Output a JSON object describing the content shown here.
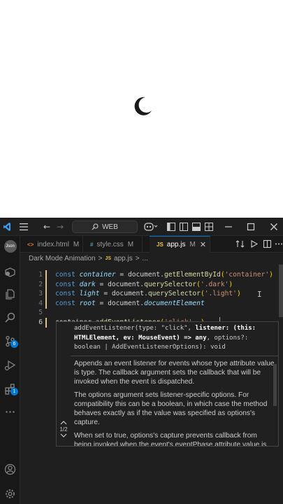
{
  "window": {
    "search_label": "WEB",
    "menu_icon": "hamburger-icon",
    "nav_back_icon": "arrow-left-icon",
    "nav_forward_icon": "arrow-right-icon",
    "copilot_icon": "copilot-icon",
    "layout_icons": [
      "sidebar-left-icon",
      "panel-bottom-icon",
      "sidebar-right-icon",
      "layout-grid-icon"
    ],
    "controls": [
      "minimize-icon",
      "maximize-icon",
      "close-icon"
    ]
  },
  "activity_bar": {
    "avatar_label": "Json",
    "items": [
      {
        "icon": "extensions-box-icon"
      },
      {
        "icon": "files-icon"
      },
      {
        "icon": "search-icon"
      },
      {
        "icon": "source-control-icon",
        "badge": "6"
      },
      {
        "icon": "run-debug-icon"
      },
      {
        "icon": "extensions-icon",
        "badge": "1"
      },
      {
        "icon": "more-icon"
      }
    ],
    "bottom": [
      {
        "icon": "account-icon"
      },
      {
        "icon": "settings-gear-icon"
      }
    ]
  },
  "tabs": [
    {
      "label": "index.html",
      "file_icon": "<>",
      "modified": "M",
      "active": false
    },
    {
      "label": "style.css",
      "file_icon": "#",
      "modified": "M",
      "active": false
    },
    {
      "label": "app.js",
      "file_icon": "JS",
      "modified": "M",
      "active": true
    }
  ],
  "breadcrumb": {
    "folder": "Dark Mode Animation",
    "separator": ">",
    "file_icon": "JS",
    "file": "app.js",
    "separator2": ">",
    "symbol": "..."
  },
  "code": {
    "lines": [
      {
        "n": "1",
        "tokens": [
          [
            "kw",
            "const "
          ],
          [
            "var",
            "container"
          ],
          [
            "plain",
            " = document."
          ],
          [
            "fn",
            "getElementById"
          ],
          [
            "bracket",
            "("
          ],
          [
            "str",
            "'container'"
          ],
          [
            "bracket",
            ")"
          ]
        ]
      },
      {
        "n": "2",
        "tokens": [
          [
            "kw",
            "const "
          ],
          [
            "var",
            "dark"
          ],
          [
            "plain",
            " = document."
          ],
          [
            "fn",
            "querySelector"
          ],
          [
            "bracket",
            "("
          ],
          [
            "str",
            "'.dark'"
          ],
          [
            "bracket",
            ")"
          ]
        ]
      },
      {
        "n": "3",
        "tokens": [
          [
            "kw",
            "const "
          ],
          [
            "var",
            "light"
          ],
          [
            "plain",
            " = document."
          ],
          [
            "fn",
            "querySelector"
          ],
          [
            "bracket",
            "("
          ],
          [
            "str",
            "'.light'"
          ],
          [
            "bracket",
            ")"
          ]
        ]
      },
      {
        "n": "4",
        "tokens": [
          [
            "kw",
            "const "
          ],
          [
            "var",
            "root"
          ],
          [
            "plain",
            " = document."
          ],
          [
            "var",
            "documentElement"
          ]
        ]
      },
      {
        "n": "5",
        "tokens": []
      },
      {
        "n": "6",
        "tokens": [
          [
            "plain",
            "container."
          ],
          [
            "fn",
            "addEventListener"
          ],
          [
            "bracket",
            "("
          ],
          [
            "str",
            "'click'"
          ],
          [
            "plain",
            ", "
          ],
          [
            "bracket",
            ")"
          ]
        ]
      }
    ]
  },
  "hover": {
    "signature_part1": "addEventListener(type: \"click\", ",
    "signature_bold": "listener: (this: HTMLElement, ev: MouseEvent) => any",
    "signature_part2": ", options?: boolean | AddEventListenerOptions): void",
    "doc1": "Appends an event listener for events whose type attribute value is type. The callback argument sets the callback that will be invoked when the event is dispatched.",
    "doc2": "The options argument sets listener-specific options. For compatibility this can be a boolean, in which case the method behaves exactly as if the value was specified as options's capture.",
    "doc3": "When set to true, options's capture prevents callback from being invoked when the event's eventPhase attribute value is",
    "page_indicator": "1/2",
    "prev_icon": "chevron-up-icon",
    "next_icon": "chevron-down-icon"
  },
  "preview": {
    "theme_toggle_icon": "moon-icon"
  },
  "colors": {
    "accent": "#0078d4",
    "modified_gutter": "#e2c08d",
    "moon": "#1a1a1a"
  }
}
